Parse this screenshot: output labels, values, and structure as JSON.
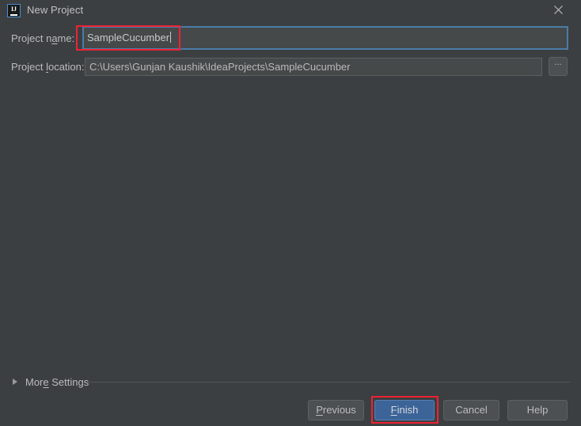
{
  "window": {
    "title": "New Project",
    "app_icon": "intellij-idea-icon",
    "close_icon": "close-icon",
    "background_color": "#3c3f41"
  },
  "form": {
    "project_name": {
      "label_before": "Project n",
      "label_mnemonic": "a",
      "label_after": "me:",
      "value": "SampleCucumber",
      "placeholder": ""
    },
    "project_location": {
      "label_before": "Project ",
      "label_mnemonic": "l",
      "label_after": "ocation:",
      "value": "C:\\Users\\Gunjan Kaushik\\IdeaProjects\\SampleCucumber",
      "placeholder": "",
      "browse_label": "...",
      "browse_icon": "ellipsis-icon"
    }
  },
  "more_settings": {
    "label_before": "Mor",
    "label_mnemonic": "e",
    "label_after": " Settings",
    "expanded": false,
    "disclosure_icon": "chevron-right-icon"
  },
  "buttons": {
    "previous": {
      "before": "",
      "mnemonic": "P",
      "after": "revious"
    },
    "finish": {
      "before": "",
      "mnemonic": "F",
      "after": "inish"
    },
    "cancel": {
      "before": "Cancel",
      "mnemonic": "",
      "after": ""
    },
    "help": {
      "before": "Help",
      "mnemonic": "",
      "after": ""
    }
  },
  "annotations": {
    "color": "#ee2233",
    "highlight_project_name": "project-name-highlight",
    "highlight_finish": "finish-button-highlight"
  },
  "colors": {
    "accent_focus": "#4a7ba8",
    "default_button": "#3c6498",
    "field_background": "#45494a",
    "text": "#bbbbbb"
  }
}
